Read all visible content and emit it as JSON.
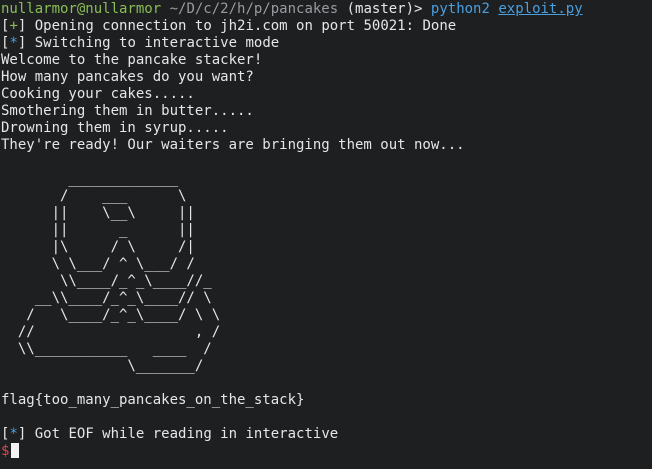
{
  "prompt": {
    "user_host": "nullarmor@nullarmor",
    "path": "~/D/c/2/h/p/pancakes",
    "branch": "(master)>",
    "command": "python2",
    "argument": "exploit.py"
  },
  "status": {
    "opening": {
      "marker": "+",
      "text": " Opening connection to jh2i.com on port 50021: Done"
    },
    "switching": {
      "marker": "*",
      "text": " Switching to interactive mode"
    },
    "eof": {
      "marker": "*",
      "text": " Got EOF while reading in interactive"
    }
  },
  "output": [
    "Welcome to the pancake stacker!",
    "How many pancakes do you want?",
    "Cooking your cakes.....",
    "Smothering them in butter.....",
    "Drowning them in syrup.....",
    "They're ready! Our waiters are bringing them out now..."
  ],
  "ascii_art": [
    "        _____________",
    "       /    ___      \\",
    "      ||    \\__\\     ||",
    "      ||      _      ||",
    "      |\\     / \\     /|",
    "      \\ \\___/ ^ \\___/ /",
    "       \\\\____/_^_\\____//_",
    "    __\\\\____/_^_\\____// \\",
    "   /   \\____/_^_\\____/ \\ \\",
    "  //                   , /",
    "  \\\\___________   ____  /",
    "               \\_______/"
  ],
  "flag": "flag{too_many_pancakes_on_the_stack}",
  "final_prompt": "$",
  "colors": {
    "background": "#1d1f21",
    "foreground": "#e6e6e6",
    "prompt_user": "#8abd57",
    "prompt_path": "#9a9aa0",
    "command": "#4a9fe0",
    "success_marker": "#8abd57",
    "info_marker": "#4a9fe0",
    "shell_dollar": "#e0454a"
  }
}
